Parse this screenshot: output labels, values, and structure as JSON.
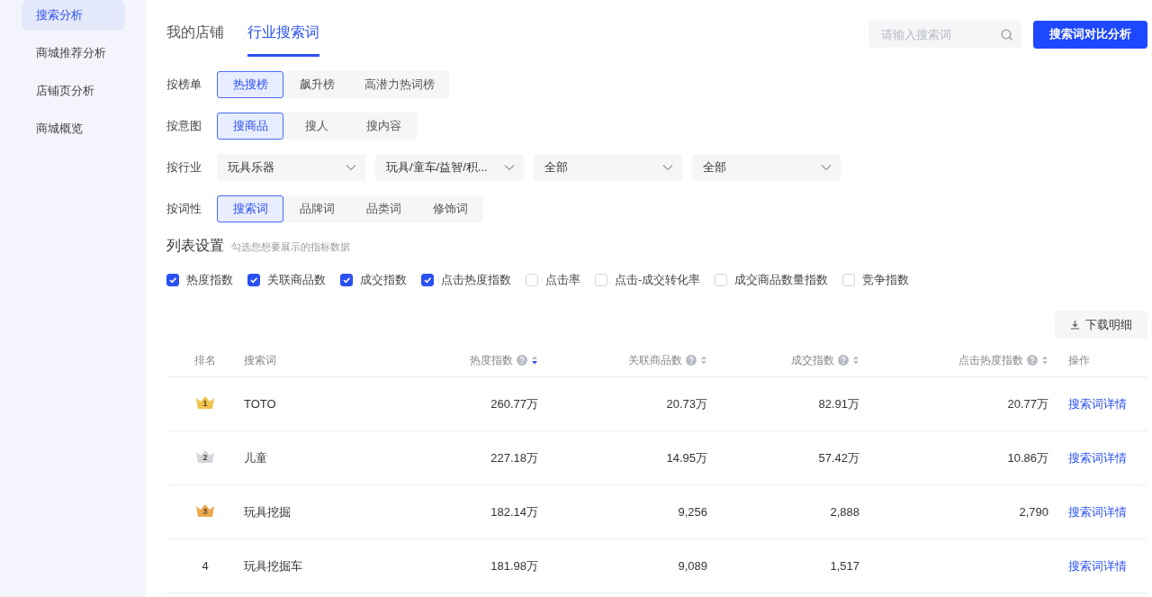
{
  "sidebar": {
    "items": [
      {
        "label": "搜索分析",
        "selected": true
      },
      {
        "label": "商城推荐分析",
        "selected": false
      },
      {
        "label": "店铺页分析",
        "selected": false
      },
      {
        "label": "商城概览",
        "selected": false
      }
    ]
  },
  "tabs": [
    {
      "label": "我的店铺",
      "selected": false
    },
    {
      "label": "行业搜索词",
      "selected": true
    }
  ],
  "search": {
    "placeholder": "请输入搜索词"
  },
  "compare_button": "搜索词对比分析",
  "filters": [
    {
      "label": "按榜单",
      "kind": "segmented",
      "options": [
        {
          "label": "热搜榜",
          "selected": true
        },
        {
          "label": "飙升榜",
          "selected": false
        },
        {
          "label": "高潜力热词榜",
          "selected": false
        }
      ]
    },
    {
      "label": "按意图",
      "kind": "segmented",
      "options": [
        {
          "label": "搜商品",
          "selected": true
        },
        {
          "label": "搜人",
          "selected": false
        },
        {
          "label": "搜内容",
          "selected": false
        }
      ]
    },
    {
      "label": "按行业",
      "kind": "selects",
      "selects": [
        {
          "value": "玩具乐器"
        },
        {
          "value": "玩具/童车/益智/积..."
        },
        {
          "value": "全部"
        },
        {
          "value": "全部"
        }
      ]
    },
    {
      "label": "按词性",
      "kind": "segmented",
      "options": [
        {
          "label": "搜索词",
          "selected": true
        },
        {
          "label": "品牌词",
          "selected": false
        },
        {
          "label": "品类词",
          "selected": false
        },
        {
          "label": "修饰词",
          "selected": false
        }
      ]
    }
  ],
  "list_settings": {
    "title": "列表设置",
    "hint": "勾选您想要展示的指标数据",
    "options": [
      {
        "label": "热度指数",
        "checked": true
      },
      {
        "label": "关联商品数",
        "checked": true
      },
      {
        "label": "成交指数",
        "checked": true
      },
      {
        "label": "点击热度指数",
        "checked": true
      },
      {
        "label": "点击率",
        "checked": false
      },
      {
        "label": "点击-成交转化率",
        "checked": false
      },
      {
        "label": "成交商品数量指数",
        "checked": false
      },
      {
        "label": "竞争指数",
        "checked": false
      }
    ]
  },
  "download_button": "下载明细",
  "table": {
    "columns": [
      {
        "label": "排名",
        "help": false
      },
      {
        "label": "搜索词",
        "help": false
      },
      {
        "label": "热度指数",
        "help": true,
        "sorted_desc": true
      },
      {
        "label": "关联商品数",
        "help": true,
        "sorted_desc": false
      },
      {
        "label": "成交指数",
        "help": true,
        "sorted_desc": false
      },
      {
        "label": "点击热度指数",
        "help": true,
        "sorted_desc": false
      },
      {
        "label": "操作",
        "help": false
      }
    ],
    "rows": [
      {
        "rank": "1",
        "kind": "medal",
        "color": "#f0c44c",
        "term": "TOTO",
        "heat": "260.77万",
        "related": "20.73万",
        "deal": "82.91万",
        "click": "20.77万",
        "action": "搜索词详情"
      },
      {
        "rank": "2",
        "kind": "medal",
        "color": "#d3d6db",
        "term": "儿童",
        "heat": "227.18万",
        "related": "14.95万",
        "deal": "57.42万",
        "click": "10.86万",
        "action": "搜索词详情"
      },
      {
        "rank": "3",
        "kind": "medal",
        "color": "#eaa94e",
        "term": "玩具挖掘",
        "heat": "182.14万",
        "related": "9,256",
        "deal": "2,888",
        "click": "2,790",
        "action": "搜索词详情"
      },
      {
        "rank": "4",
        "kind": "plain",
        "term": "玩具挖掘车",
        "heat": "181.98万",
        "related": "9,089",
        "deal": "1,517",
        "action": "搜索词详情"
      }
    ]
  }
}
